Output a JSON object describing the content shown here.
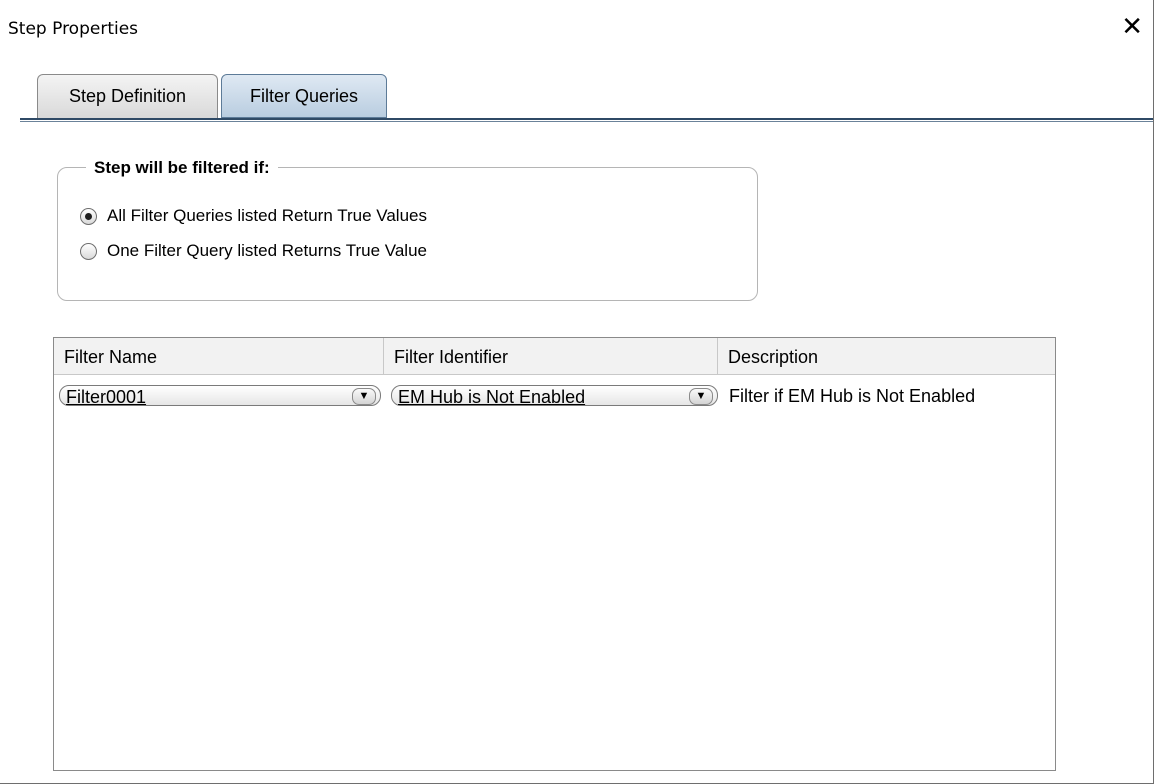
{
  "window": {
    "title": "Step Properties",
    "close_glyph": "✕"
  },
  "tabs": [
    {
      "label": "Step Definition",
      "active": false
    },
    {
      "label": "Filter Queries",
      "active": true
    }
  ],
  "filter_group": {
    "title": "Step will be filtered if:",
    "options": [
      {
        "label": "All Filter Queries listed Return True Values",
        "selected": true
      },
      {
        "label": "One Filter Query listed Returns True Value",
        "selected": false
      }
    ]
  },
  "table": {
    "columns": [
      "Filter Name",
      "Filter Identifier",
      "Description"
    ],
    "rows": [
      {
        "filter_name": "Filter0001",
        "filter_identifier": "EM Hub is Not Enabled",
        "description": "Filter if EM Hub is Not Enabled"
      }
    ]
  },
  "icons": {
    "dropdown_arrow": "▼"
  }
}
